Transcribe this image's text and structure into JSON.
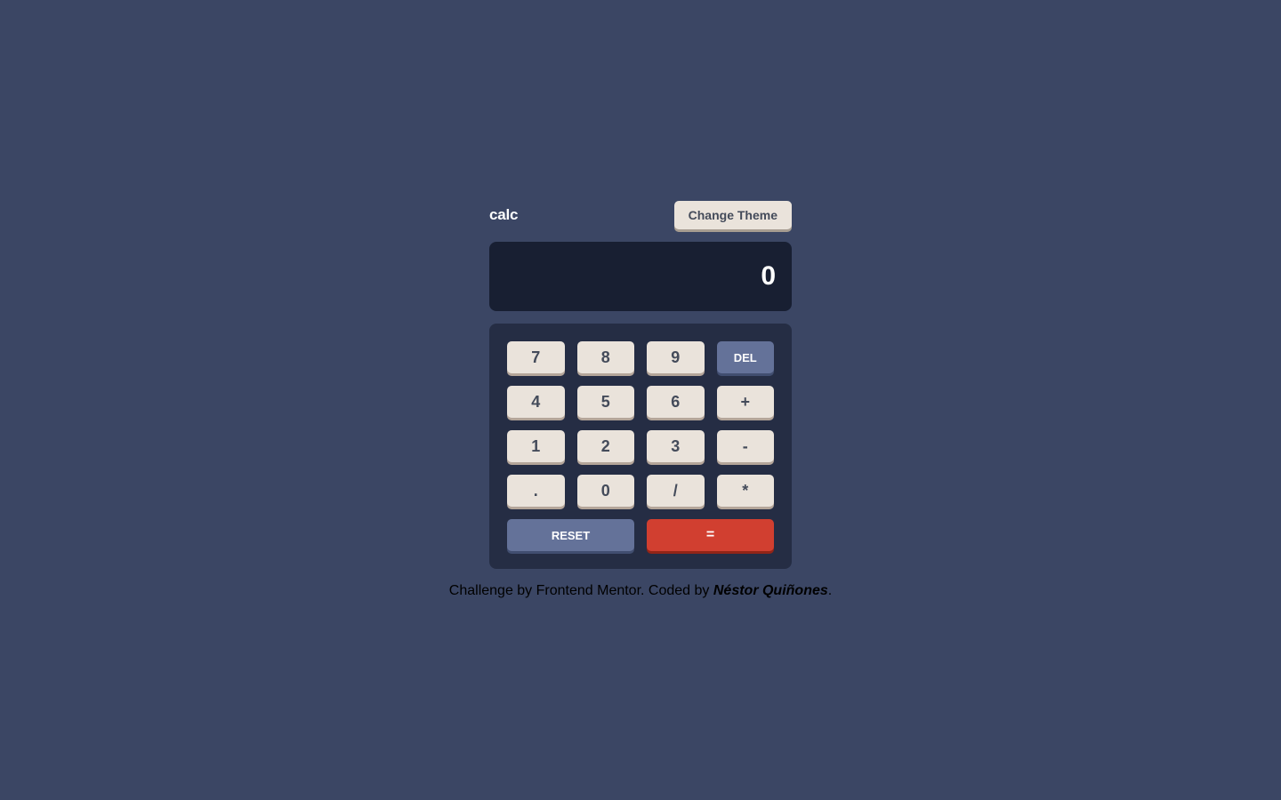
{
  "header": {
    "logo": "calc",
    "theme_btn": "Change Theme"
  },
  "display": {
    "value": "0"
  },
  "keys": {
    "k7": "7",
    "k8": "8",
    "k9": "9",
    "del": "DEL",
    "k4": "4",
    "k5": "5",
    "k6": "6",
    "plus": "+",
    "k1": "1",
    "k2": "2",
    "k3": "3",
    "minus": "-",
    "dot": ".",
    "k0": "0",
    "div": "/",
    "mul": "*",
    "reset": "RESET",
    "eq": "="
  },
  "footer": {
    "prefix": "Challenge by Frontend Mentor. Coded by ",
    "author": "Néstor Quiñones",
    "suffix": "."
  }
}
